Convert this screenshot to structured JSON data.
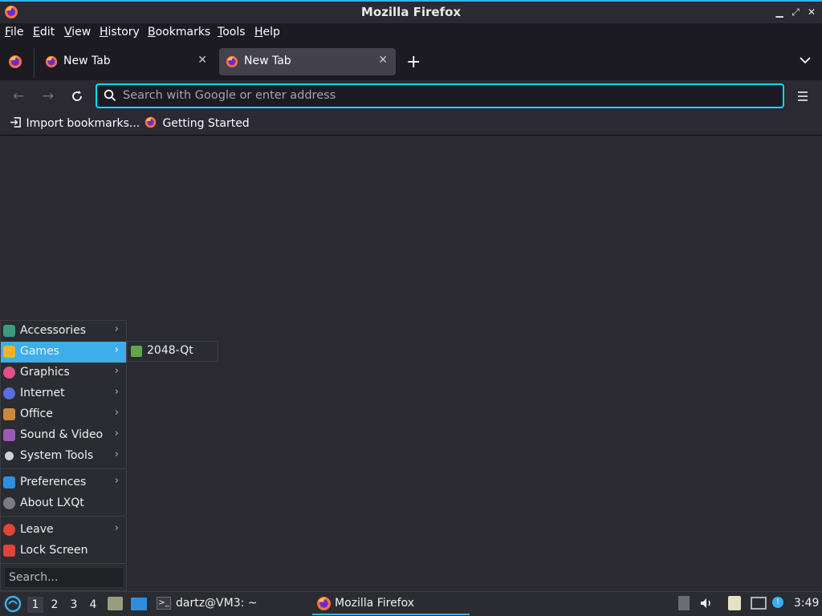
{
  "window": {
    "title": "Mozilla Firefox"
  },
  "menubar": {
    "items": [
      {
        "label": "File",
        "underline": "F"
      },
      {
        "label": "Edit",
        "underline": "E"
      },
      {
        "label": "View",
        "underline": "V"
      },
      {
        "label": "History",
        "underline": "H"
      },
      {
        "label": "Bookmarks",
        "underline": "B"
      },
      {
        "label": "Tools",
        "underline": "T"
      },
      {
        "label": "Help",
        "underline": "H"
      }
    ]
  },
  "tabs": [
    {
      "label": "New Tab",
      "active": false
    },
    {
      "label": "New Tab",
      "active": true
    }
  ],
  "urlbar": {
    "placeholder": "Search with Google or enter address"
  },
  "bookmarks": [
    {
      "label": "Import bookmarks...",
      "icon": "import-icon"
    },
    {
      "label": "Getting Started",
      "icon": "firefox-icon"
    }
  ],
  "startmenu": {
    "items": [
      {
        "label": "Accessories",
        "icon": "accessories-icon",
        "submenu": true,
        "color": "#3c9a7e"
      },
      {
        "label": "Games",
        "icon": "games-icon",
        "submenu": true,
        "color": "#f0b429",
        "active": true
      },
      {
        "label": "Graphics",
        "icon": "graphics-icon",
        "submenu": true,
        "color": "#e0508a"
      },
      {
        "label": "Internet",
        "icon": "internet-icon",
        "submenu": true,
        "color": "#5b6ee1"
      },
      {
        "label": "Office",
        "icon": "office-icon",
        "submenu": true,
        "color": "#c98a3d"
      },
      {
        "label": "Sound & Video",
        "icon": "sound-video-icon",
        "submenu": true,
        "color": "#9b59b6"
      },
      {
        "label": "System Tools",
        "icon": "system-tools-icon",
        "submenu": true,
        "color": "#d0d2d6"
      },
      {
        "label": "Preferences",
        "icon": "preferences-icon",
        "submenu": true,
        "color": "#2d8ee0"
      },
      {
        "label": "About LXQt",
        "icon": "info-icon",
        "submenu": false,
        "color": "#7a7c80"
      },
      {
        "label": "Leave",
        "icon": "power-icon",
        "submenu": true,
        "color": "#e0443a"
      },
      {
        "label": "Lock Screen",
        "icon": "lock-icon",
        "submenu": false,
        "color": "#e0443a"
      }
    ],
    "search_placeholder": "Search...",
    "submenu": {
      "label": "2048-Qt",
      "icon": "game-2048-icon"
    }
  },
  "taskbar": {
    "workspaces": [
      "1",
      "2",
      "3",
      "4"
    ],
    "active_workspace": "1",
    "tasks": [
      {
        "label": "dartz@VM3: ~",
        "icon": "terminal-icon"
      },
      {
        "label": "Mozilla Firefox",
        "icon": "firefox-icon",
        "active": true
      }
    ],
    "clock": "3:49"
  },
  "colors": {
    "accent": "#3daee9",
    "urlbar_focus": "#00ddff",
    "bg": "#2b2a33"
  }
}
